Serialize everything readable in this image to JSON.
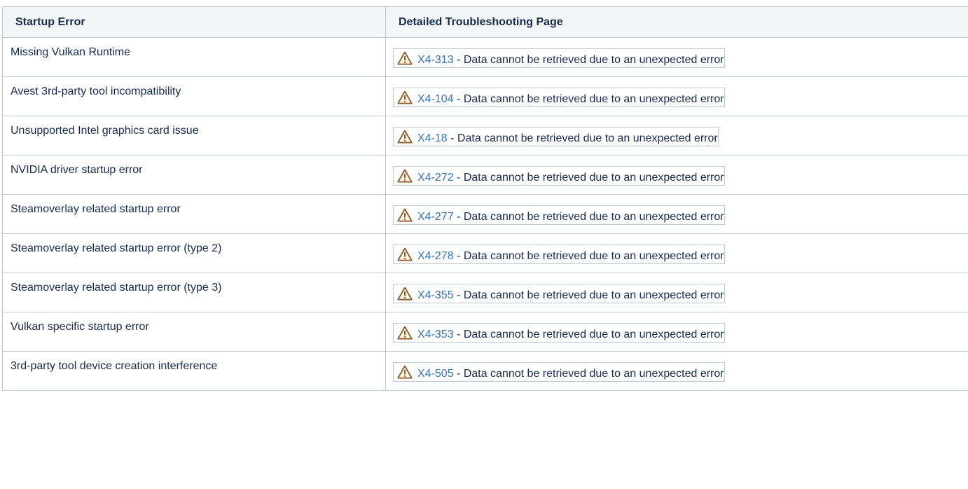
{
  "table": {
    "headers": {
      "error": "Startup Error",
      "page": "Detailed Troubleshooting Page"
    },
    "rows": [
      {
        "error": "Missing Vulkan Runtime",
        "key": "X4-313",
        "message": " - Data cannot be retrieved due to an unexpected error"
      },
      {
        "error": "Avest 3rd-party tool incompatibility",
        "key": "X4-104",
        "message": " - Data cannot be retrieved due to an unexpected error"
      },
      {
        "error": "Unsupported Intel graphics card issue",
        "key": "X4-18",
        "message": " - Data cannot be retrieved due to an unexpected error"
      },
      {
        "error": "NVIDIA driver startup error",
        "key": "X4-272",
        "message": " - Data cannot be retrieved due to an unexpected error"
      },
      {
        "error": "Steamoverlay related startup error",
        "key": "X4-277",
        "message": " - Data cannot be retrieved due to an unexpected error"
      },
      {
        "error": "Steamoverlay related startup error (type 2)",
        "key": "X4-278",
        "message": " - Data cannot be retrieved due to an unexpected error"
      },
      {
        "error": "Steamoverlay related startup error (type 3)",
        "key": "X4-355",
        "message": " - Data cannot be retrieved due to an unexpected error"
      },
      {
        "error": "Vulkan specific startup error",
        "key": "X4-353",
        "message": " - Data cannot be retrieved due to an unexpected error"
      },
      {
        "error": "3rd-party tool device creation interference",
        "key": "X4-505",
        "message": " - Data cannot be retrieved due to an unexpected error"
      }
    ]
  },
  "colors": {
    "link": "#3572b0",
    "border": "#c1c7d0",
    "header_bg": "#f4f5f7",
    "warning_icon": "#8b5a2b"
  },
  "icons": {
    "warning": "warning-triangle-icon"
  }
}
